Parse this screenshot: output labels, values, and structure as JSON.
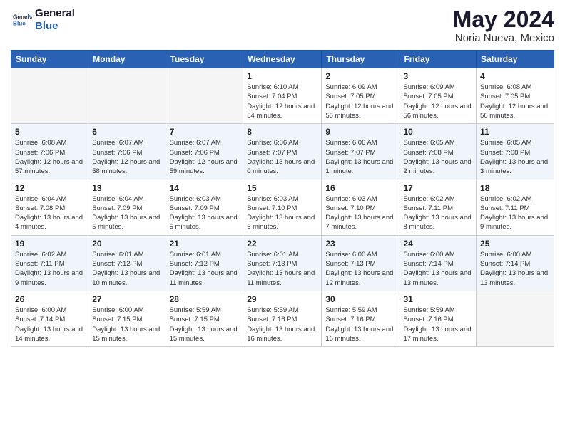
{
  "logo": {
    "line1": "General",
    "line2": "Blue"
  },
  "title": "May 2024",
  "location": "Noria Nueva, Mexico",
  "days_of_week": [
    "Sunday",
    "Monday",
    "Tuesday",
    "Wednesday",
    "Thursday",
    "Friday",
    "Saturday"
  ],
  "weeks": [
    [
      {
        "day": "",
        "empty": true
      },
      {
        "day": "",
        "empty": true
      },
      {
        "day": "",
        "empty": true
      },
      {
        "day": "1",
        "sunrise": "6:10 AM",
        "sunset": "7:04 PM",
        "daylight": "12 hours and 54 minutes."
      },
      {
        "day": "2",
        "sunrise": "6:09 AM",
        "sunset": "7:05 PM",
        "daylight": "12 hours and 55 minutes."
      },
      {
        "day": "3",
        "sunrise": "6:09 AM",
        "sunset": "7:05 PM",
        "daylight": "12 hours and 56 minutes."
      },
      {
        "day": "4",
        "sunrise": "6:08 AM",
        "sunset": "7:05 PM",
        "daylight": "12 hours and 56 minutes."
      }
    ],
    [
      {
        "day": "5",
        "sunrise": "6:08 AM",
        "sunset": "7:06 PM",
        "daylight": "12 hours and 57 minutes."
      },
      {
        "day": "6",
        "sunrise": "6:07 AM",
        "sunset": "7:06 PM",
        "daylight": "12 hours and 58 minutes."
      },
      {
        "day": "7",
        "sunrise": "6:07 AM",
        "sunset": "7:06 PM",
        "daylight": "12 hours and 59 minutes."
      },
      {
        "day": "8",
        "sunrise": "6:06 AM",
        "sunset": "7:07 PM",
        "daylight": "13 hours and 0 minutes."
      },
      {
        "day": "9",
        "sunrise": "6:06 AM",
        "sunset": "7:07 PM",
        "daylight": "13 hours and 1 minute."
      },
      {
        "day": "10",
        "sunrise": "6:05 AM",
        "sunset": "7:08 PM",
        "daylight": "13 hours and 2 minutes."
      },
      {
        "day": "11",
        "sunrise": "6:05 AM",
        "sunset": "7:08 PM",
        "daylight": "13 hours and 3 minutes."
      }
    ],
    [
      {
        "day": "12",
        "sunrise": "6:04 AM",
        "sunset": "7:08 PM",
        "daylight": "13 hours and 4 minutes."
      },
      {
        "day": "13",
        "sunrise": "6:04 AM",
        "sunset": "7:09 PM",
        "daylight": "13 hours and 5 minutes."
      },
      {
        "day": "14",
        "sunrise": "6:03 AM",
        "sunset": "7:09 PM",
        "daylight": "13 hours and 5 minutes."
      },
      {
        "day": "15",
        "sunrise": "6:03 AM",
        "sunset": "7:10 PM",
        "daylight": "13 hours and 6 minutes."
      },
      {
        "day": "16",
        "sunrise": "6:03 AM",
        "sunset": "7:10 PM",
        "daylight": "13 hours and 7 minutes."
      },
      {
        "day": "17",
        "sunrise": "6:02 AM",
        "sunset": "7:11 PM",
        "daylight": "13 hours and 8 minutes."
      },
      {
        "day": "18",
        "sunrise": "6:02 AM",
        "sunset": "7:11 PM",
        "daylight": "13 hours and 9 minutes."
      }
    ],
    [
      {
        "day": "19",
        "sunrise": "6:02 AM",
        "sunset": "7:11 PM",
        "daylight": "13 hours and 9 minutes."
      },
      {
        "day": "20",
        "sunrise": "6:01 AM",
        "sunset": "7:12 PM",
        "daylight": "13 hours and 10 minutes."
      },
      {
        "day": "21",
        "sunrise": "6:01 AM",
        "sunset": "7:12 PM",
        "daylight": "13 hours and 11 minutes."
      },
      {
        "day": "22",
        "sunrise": "6:01 AM",
        "sunset": "7:13 PM",
        "daylight": "13 hours and 11 minutes."
      },
      {
        "day": "23",
        "sunrise": "6:00 AM",
        "sunset": "7:13 PM",
        "daylight": "13 hours and 12 minutes."
      },
      {
        "day": "24",
        "sunrise": "6:00 AM",
        "sunset": "7:14 PM",
        "daylight": "13 hours and 13 minutes."
      },
      {
        "day": "25",
        "sunrise": "6:00 AM",
        "sunset": "7:14 PM",
        "daylight": "13 hours and 13 minutes."
      }
    ],
    [
      {
        "day": "26",
        "sunrise": "6:00 AM",
        "sunset": "7:14 PM",
        "daylight": "13 hours and 14 minutes."
      },
      {
        "day": "27",
        "sunrise": "6:00 AM",
        "sunset": "7:15 PM",
        "daylight": "13 hours and 15 minutes."
      },
      {
        "day": "28",
        "sunrise": "5:59 AM",
        "sunset": "7:15 PM",
        "daylight": "13 hours and 15 minutes."
      },
      {
        "day": "29",
        "sunrise": "5:59 AM",
        "sunset": "7:16 PM",
        "daylight": "13 hours and 16 minutes."
      },
      {
        "day": "30",
        "sunrise": "5:59 AM",
        "sunset": "7:16 PM",
        "daylight": "13 hours and 16 minutes."
      },
      {
        "day": "31",
        "sunrise": "5:59 AM",
        "sunset": "7:16 PM",
        "daylight": "13 hours and 17 minutes."
      },
      {
        "day": "",
        "empty": true
      }
    ]
  ]
}
